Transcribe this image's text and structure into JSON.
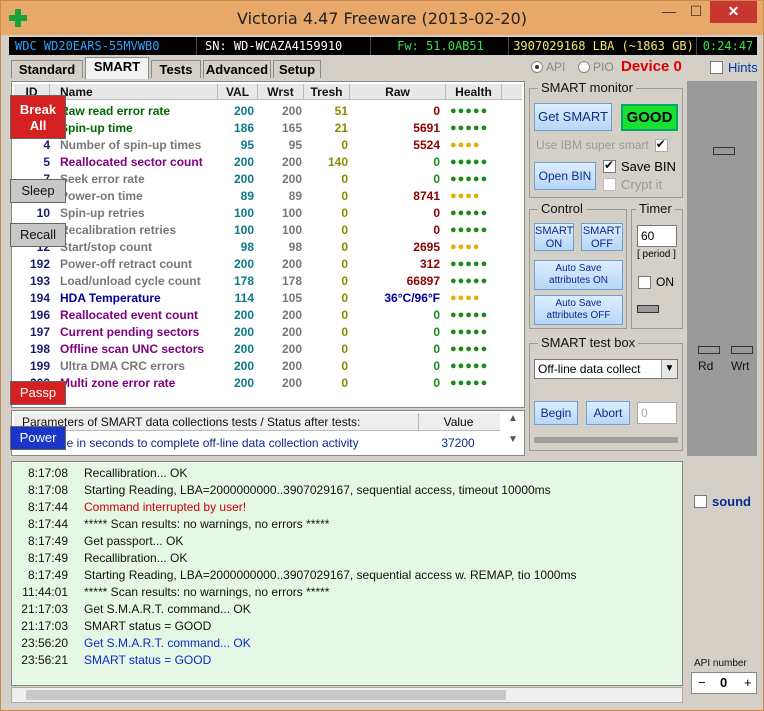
{
  "window": {
    "title": "Victoria 4.47  Freeware (2013-02-20)",
    "controls": {
      "minimize": "—",
      "maximize": "☐",
      "close": "✕"
    }
  },
  "infobar": {
    "model": "WDC WD20EARS-55MVWB0",
    "serial": "SN: WD-WCAZA4159910",
    "firmware": "Fw: 51.0AB51",
    "lba": "3907029168 LBA (~1863 GB)",
    "time": "0:24:47"
  },
  "tabs": [
    "Standard",
    "SMART",
    "Tests",
    "Advanced",
    "Setup"
  ],
  "active_tab": "SMART",
  "mode": {
    "api_label": "API",
    "pio_label": "PIO",
    "selected": "API"
  },
  "device_label": "Device 0",
  "hints_label": "Hints",
  "smart_table": {
    "headers": [
      "ID",
      "Name",
      "VAL",
      "Wrst",
      "Tresh",
      "Raw",
      "Health"
    ],
    "rows": [
      {
        "id": "1",
        "name": "Raw read error rate",
        "val": "200",
        "wrst": "200",
        "tresh": "51",
        "raw": "0",
        "health": "●●●●●",
        "name_color": "#006600",
        "raw_color": "#8b0000",
        "health_color": "#1a8a1a"
      },
      {
        "id": "3",
        "name": "Spin-up time",
        "val": "186",
        "wrst": "165",
        "tresh": "21",
        "raw": "5691",
        "health": "●●●●●",
        "name_color": "#006600",
        "raw_color": "#8b0000",
        "health_color": "#1a8a1a"
      },
      {
        "id": "4",
        "name": "Number of spin-up times",
        "val": "95",
        "wrst": "95",
        "tresh": "0",
        "raw": "5524",
        "health": "●●●●",
        "name_color": "#777777",
        "raw_color": "#8b0000",
        "health_color": "#e0b000"
      },
      {
        "id": "5",
        "name": "Reallocated sector count",
        "val": "200",
        "wrst": "200",
        "tresh": "140",
        "raw": "0",
        "health": "●●●●●",
        "name_color": "#800080",
        "raw_color": "#1a8a1a",
        "health_color": "#1a8a1a"
      },
      {
        "id": "7",
        "name": "Seek error rate",
        "val": "200",
        "wrst": "200",
        "tresh": "0",
        "raw": "0",
        "health": "●●●●●",
        "name_color": "#777777",
        "raw_color": "#1a8a1a",
        "health_color": "#1a8a1a"
      },
      {
        "id": "9",
        "name": "Power-on time",
        "val": "89",
        "wrst": "89",
        "tresh": "0",
        "raw": "8741",
        "health": "●●●●",
        "name_color": "#777777",
        "raw_color": "#8b0000",
        "health_color": "#e0b000"
      },
      {
        "id": "10",
        "name": "Spin-up retries",
        "val": "100",
        "wrst": "100",
        "tresh": "0",
        "raw": "0",
        "health": "●●●●●",
        "name_color": "#777777",
        "raw_color": "#8b0000",
        "health_color": "#1a8a1a"
      },
      {
        "id": "11",
        "name": "Recalibration retries",
        "val": "100",
        "wrst": "100",
        "tresh": "0",
        "raw": "0",
        "health": "●●●●●",
        "name_color": "#777777",
        "raw_color": "#8b0000",
        "health_color": "#1a8a1a"
      },
      {
        "id": "12",
        "name": "Start/stop count",
        "val": "98",
        "wrst": "98",
        "tresh": "0",
        "raw": "2695",
        "health": "●●●●",
        "name_color": "#777777",
        "raw_color": "#8b0000",
        "health_color": "#e0b000"
      },
      {
        "id": "192",
        "name": "Power-off retract count",
        "val": "200",
        "wrst": "200",
        "tresh": "0",
        "raw": "312",
        "health": "●●●●●",
        "name_color": "#777777",
        "raw_color": "#8b0000",
        "health_color": "#1a8a1a"
      },
      {
        "id": "193",
        "name": "Load/unload cycle count",
        "val": "178",
        "wrst": "178",
        "tresh": "0",
        "raw": "66897",
        "health": "●●●●●",
        "name_color": "#777777",
        "raw_color": "#8b0000",
        "health_color": "#1a8a1a"
      },
      {
        "id": "194",
        "name": "HDA Temperature",
        "val": "114",
        "wrst": "105",
        "tresh": "0",
        "raw": "36°C/96°F",
        "health": "●●●●",
        "name_color": "#000099",
        "raw_color": "#000099",
        "health_color": "#e0b000"
      },
      {
        "id": "196",
        "name": "Reallocated event count",
        "val": "200",
        "wrst": "200",
        "tresh": "0",
        "raw": "0",
        "health": "●●●●●",
        "name_color": "#800080",
        "raw_color": "#1a8a1a",
        "health_color": "#1a8a1a"
      },
      {
        "id": "197",
        "name": "Current pending sectors",
        "val": "200",
        "wrst": "200",
        "tresh": "0",
        "raw": "0",
        "health": "●●●●●",
        "name_color": "#800080",
        "raw_color": "#1a8a1a",
        "health_color": "#1a8a1a"
      },
      {
        "id": "198",
        "name": "Offline scan UNC sectors",
        "val": "200",
        "wrst": "200",
        "tresh": "0",
        "raw": "0",
        "health": "●●●●●",
        "name_color": "#800080",
        "raw_color": "#1a8a1a",
        "health_color": "#1a8a1a"
      },
      {
        "id": "199",
        "name": "Ultra DMA CRC errors",
        "val": "200",
        "wrst": "200",
        "tresh": "0",
        "raw": "0",
        "health": "●●●●●",
        "name_color": "#777777",
        "raw_color": "#1a8a1a",
        "health_color": "#1a8a1a"
      },
      {
        "id": "200",
        "name": "Multi zone error rate",
        "val": "200",
        "wrst": "200",
        "tresh": "0",
        "raw": "0",
        "health": "●●●●●",
        "name_color": "#800080",
        "raw_color": "#1a8a1a",
        "health_color": "#1a8a1a"
      }
    ]
  },
  "params": {
    "header": "Parameters of SMART data collections tests / Status after tests:",
    "value_header": "Value",
    "row_label": "Total time in seconds to complete off-line data collection activity",
    "row_value": "37200"
  },
  "smart_monitor": {
    "title": "SMART monitor",
    "get_smart": "Get SMART",
    "status": "GOOD",
    "use_ibm": "Use IBM super smart",
    "open_bin": "Open BIN",
    "save_bin": "Save BIN",
    "crypt_it": "Crypt it"
  },
  "control": {
    "title": "Control",
    "smart_on": "SMART ON",
    "smart_off": "SMART OFF",
    "autosave_on": "Auto Save attributes ON",
    "autosave_off": "Auto Save attributes OFF"
  },
  "timer": {
    "title": "Timer",
    "value": "60",
    "period": "[ period ]",
    "on_label": "ON"
  },
  "smart_test": {
    "title": "SMART test box",
    "selected": "Off-line data collect",
    "begin": "Begin",
    "abort": "Abort",
    "counter": "0"
  },
  "right": {
    "break_all": "Break All",
    "sleep": "Sleep",
    "recall": "Recall",
    "rd": "Rd",
    "wrt": "Wrt",
    "passp": "Passp",
    "power": "Power",
    "sound": "sound",
    "api_number_label": "API number",
    "api_minus": "−",
    "api_value": "0",
    "api_plus": "+"
  },
  "log": [
    {
      "time": "8:17:08",
      "msg": "Recallibration... OK",
      "color": "#111111"
    },
    {
      "time": "8:17:08",
      "msg": "Starting Reading, LBA=2000000000..3907029167, sequential access, timeout 10000ms",
      "color": "#111111"
    },
    {
      "time": "8:17:44",
      "msg": "Command interrupted by user!",
      "color": "#cc0000"
    },
    {
      "time": "8:17:44",
      "msg": "***** Scan results: no warnings, no errors *****",
      "color": "#111111"
    },
    {
      "time": "8:17:49",
      "msg": "Get passport... OK",
      "color": "#111111"
    },
    {
      "time": "8:17:49",
      "msg": "Recallibration... OK",
      "color": "#111111"
    },
    {
      "time": "8:17:49",
      "msg": "Starting Reading, LBA=2000000000..3907029167, sequential access w. REMAP, tio 1000ms",
      "color": "#111111"
    },
    {
      "time": "11:44:01",
      "msg": "***** Scan results: no warnings, no errors *****",
      "color": "#111111"
    },
    {
      "time": "21:17:03",
      "msg": "Get S.M.A.R.T. command... OK",
      "color": "#111111"
    },
    {
      "time": "21:17:03",
      "msg": "SMART status = GOOD",
      "color": "#111111"
    },
    {
      "time": "23:56:20",
      "msg": "Get S.M.A.R.T. command... OK",
      "color": "#0b2acc"
    },
    {
      "time": "23:56:21",
      "msg": "SMART status = GOOD",
      "color": "#0b2acc"
    }
  ]
}
